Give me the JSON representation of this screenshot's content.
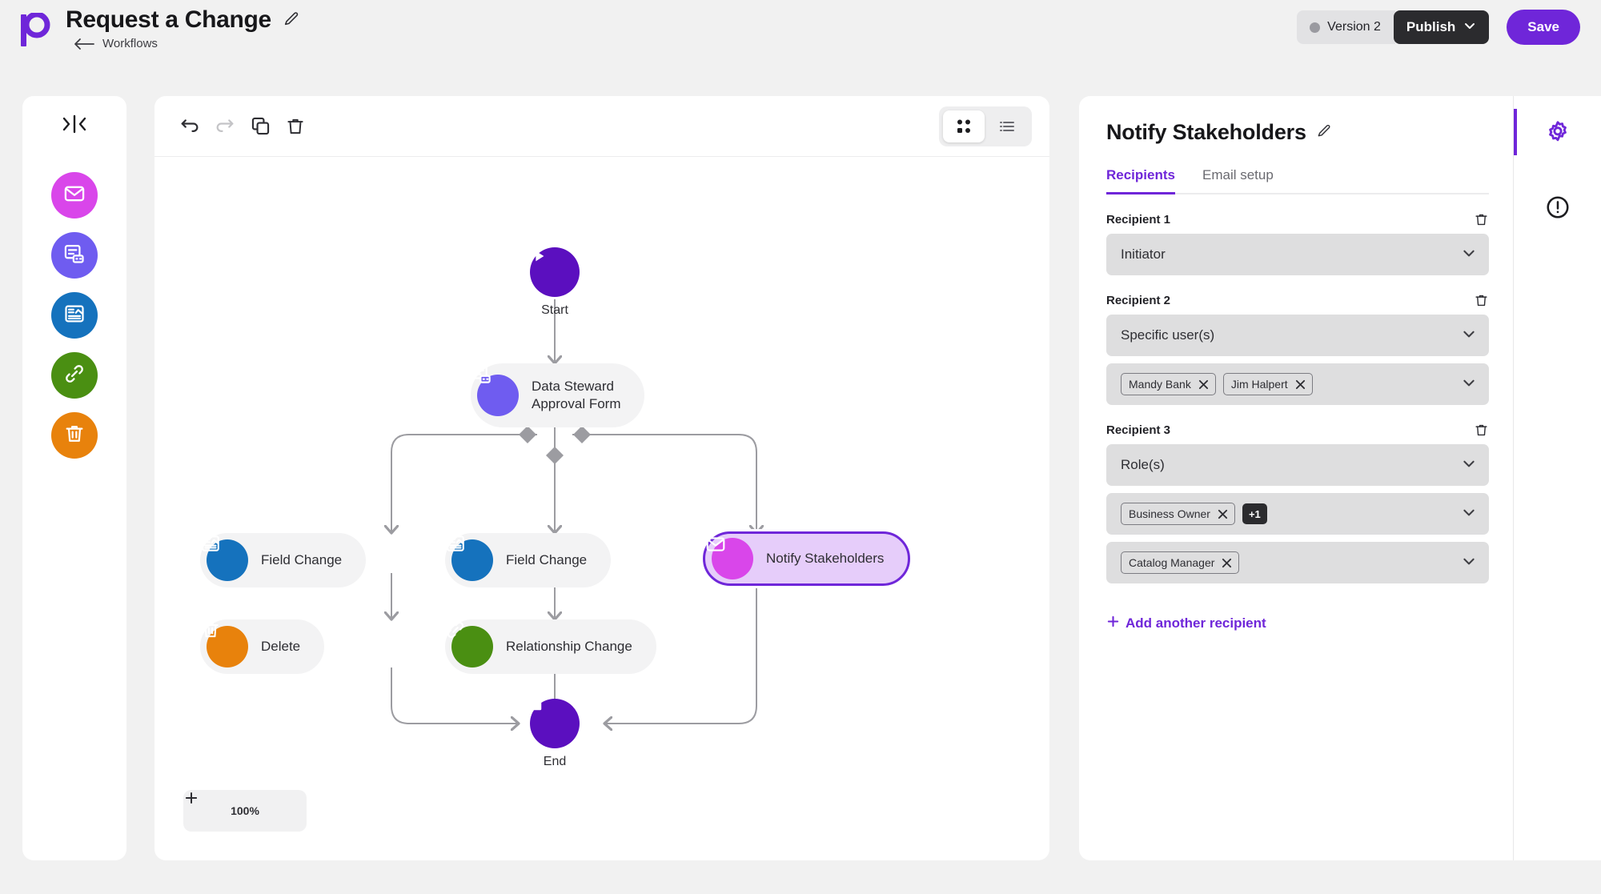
{
  "header": {
    "logo": "logo-p-mark",
    "title": "Request a Change",
    "edit_icon": "pencil-icon",
    "breadcrumb_back_icon": "arrow-left-icon",
    "breadcrumb": "Workflows",
    "version_label": "Version 2",
    "publish_label": "Publish",
    "publish_caret_icon": "chevron-down-icon",
    "save_label": "Save",
    "accent": "#6f26d9",
    "publish_bg": "#2b2b2e"
  },
  "left_rail": {
    "collapse_icon": "collapse-panel-icon",
    "items": [
      {
        "name": "notify-stakeholders",
        "icon": "envelope-icon",
        "color": "#d946ea"
      },
      {
        "name": "approval-form",
        "icon": "form-icon",
        "color": "#6f5cf0"
      },
      {
        "name": "field-change",
        "icon": "document-image-icon",
        "color": "#1572bd"
      },
      {
        "name": "relationship-change",
        "icon": "link-icon",
        "color": "#4a8f12"
      },
      {
        "name": "delete",
        "icon": "trash-icon",
        "color": "#e8820c"
      }
    ]
  },
  "canvas": {
    "toolbar": {
      "undo_icon": "undo-icon",
      "redo_icon": "redo-icon",
      "duplicate_icon": "copy-icon",
      "delete_icon": "trash-icon",
      "view_grid_icon": "grid-view-icon",
      "view_list_icon": "list-view-icon",
      "active_view": "grid"
    },
    "zoom": {
      "minus_icon": "minus-icon",
      "value": "100%",
      "plus_icon": "plus-icon"
    },
    "start_label": "Start",
    "end_label": "End",
    "nodes": [
      {
        "id": "approval",
        "label": "Data Steward\nApproval Form",
        "label_line1": "Data Steward",
        "label_line2": "Approval Form",
        "icon": "form-icon",
        "color": "#6f5cf0",
        "selected": false
      },
      {
        "id": "field1",
        "label": "Field Change",
        "icon": "document-image-icon",
        "color": "#1572bd",
        "selected": false
      },
      {
        "id": "field2",
        "label": "Field Change",
        "icon": "document-image-icon",
        "color": "#1572bd",
        "selected": false
      },
      {
        "id": "notify",
        "label": "Notify Stakeholders",
        "icon": "envelope-icon",
        "color": "#d946ea",
        "selected": true
      },
      {
        "id": "delete",
        "label": "Delete",
        "icon": "trash-icon",
        "color": "#e8820c",
        "selected": false
      },
      {
        "id": "relationship",
        "label": "Relationship Change",
        "icon": "link-icon",
        "color": "#4a8f12",
        "selected": false
      }
    ]
  },
  "panel": {
    "title": "Notify Stakeholders",
    "edit_icon": "pencil-icon",
    "tabs": [
      {
        "label": "Recipients",
        "active": true
      },
      {
        "label": "Email setup",
        "active": false
      }
    ],
    "recipients": [
      {
        "label": "Recipient 1",
        "delete_icon": "trash-icon",
        "type": "Initiator",
        "caret_icon": "chevron-down-icon",
        "value_rows": []
      },
      {
        "label": "Recipient 2",
        "delete_icon": "trash-icon",
        "type": "Specific user(s)",
        "caret_icon": "chevron-down-icon",
        "value_rows": [
          {
            "chips": [
              "Mandy Bank",
              "Jim Halpert"
            ],
            "more": ""
          }
        ]
      },
      {
        "label": "Recipient 3",
        "delete_icon": "trash-icon",
        "type": "Role(s)",
        "caret_icon": "chevron-down-icon",
        "value_rows": [
          {
            "chips": [
              "Business Owner"
            ],
            "more": "+1"
          },
          {
            "chips": [
              "Catalog Manager"
            ],
            "more": ""
          }
        ]
      }
    ],
    "add_recipient": "Add another recipient",
    "add_icon": "plus-icon"
  },
  "right_rail": {
    "items": [
      {
        "name": "settings",
        "icon": "gear-icon",
        "active": true,
        "color": "#6f26d9"
      },
      {
        "name": "issues",
        "icon": "alert-circle-icon",
        "active": false,
        "color": "#1d1d20"
      }
    ]
  }
}
